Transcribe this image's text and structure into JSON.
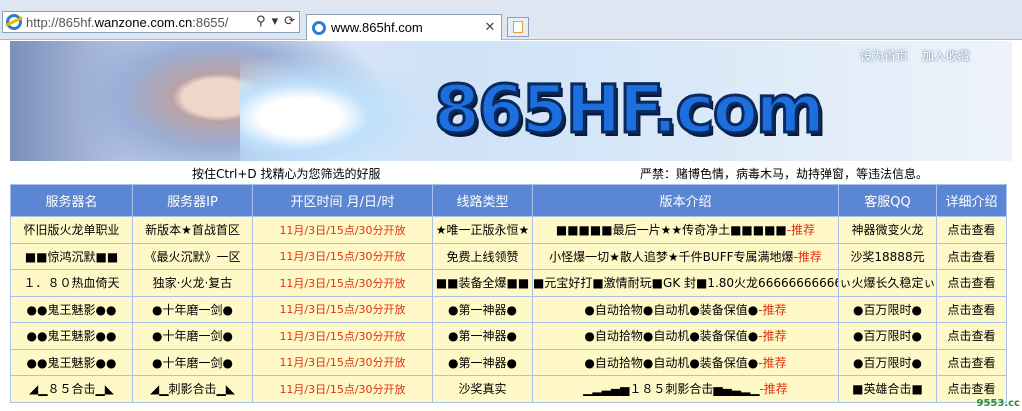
{
  "browser": {
    "address_url_prefix": "http://865hf.",
    "address_url_domain": "wanzone.com.cn",
    "address_url_suffix": ":8655/",
    "tab_title": "www.865hf.com"
  },
  "banner": {
    "logo": "865HF.com",
    "link_home": "设为首页",
    "link_fav": "加入收藏"
  },
  "notice": {
    "left": "按住Ctrl+D 找精心为您筛选的好服",
    "right": "严禁：赌博色情，病毒木马，劫持弹窗，等违法信息。"
  },
  "table": {
    "headers": [
      "服务器名",
      "服务器IP",
      "开区时间 月/日/时",
      "线路类型",
      "版本介绍",
      "客服QQ",
      "详细介绍"
    ],
    "rec_label": "-推荐",
    "more_label": "点击查看",
    "rows": [
      {
        "name": "怀旧版火龙单职业",
        "ip": "新版本★首战首区",
        "time": "11月/3日/15点/30分开放",
        "line": "★唯一正版永恒★",
        "intro": "■■■■■最后一片★★传奇净土■■■■■",
        "rec": true,
        "qq": "神器微变火龙"
      },
      {
        "name": "■■惊鸿沉默■■",
        "ip": "《最火沉默》一区",
        "time": "11月/3日/15点/30分开放",
        "line": "免费上线领赞",
        "intro": "小怪爆一切★散人追梦★千件BUFF专属满地爆",
        "rec": true,
        "qq": "沙奖18888元"
      },
      {
        "name": "１．８０热血倚天",
        "ip": "独家·火龙·复古",
        "time": "11月/3日/15点/30分开放",
        "line": "■■装备全爆■■",
        "intro": "■元宝好打■激情耐玩■GK 封■1.80火龙66666666666666",
        "rec": false,
        "qq": "ぃ火爆长久稳定ぃ"
      },
      {
        "name": "●●鬼王魅影●●",
        "ip": "●十年磨一剑●",
        "time": "11月/3日/15点/30分开放",
        "line": "●第一神器●",
        "intro": "●自动拾物●自动机●装备保值●",
        "rec": true,
        "qq": "●百万限时●"
      },
      {
        "name": "●●鬼王魅影●●",
        "ip": "●十年磨一剑●",
        "time": "11月/3日/15点/30分开放",
        "line": "●第一神器●",
        "intro": "●自动拾物●自动机●装备保值●",
        "rec": true,
        "qq": "●百万限时●"
      },
      {
        "name": "●●鬼王魅影●●",
        "ip": "●十年磨一剑●",
        "time": "11月/3日/15点/30分开放",
        "line": "●第一神器●",
        "intro": "●自动拾物●自动机●装备保值●",
        "rec": true,
        "qq": "●百万限时●"
      },
      {
        "name": "◢▁８５合击▁◣",
        "ip": "◢▁刺影合击▁◣",
        "time": "11月/3日/15点/30分开放",
        "line": "沙奖真实",
        "intro": "▁▂▃▄▅１８５刺影合击▅▄▃▂▁",
        "rec": true,
        "qq": "■英雄合击■"
      }
    ]
  },
  "watermark": "9553.cc"
}
